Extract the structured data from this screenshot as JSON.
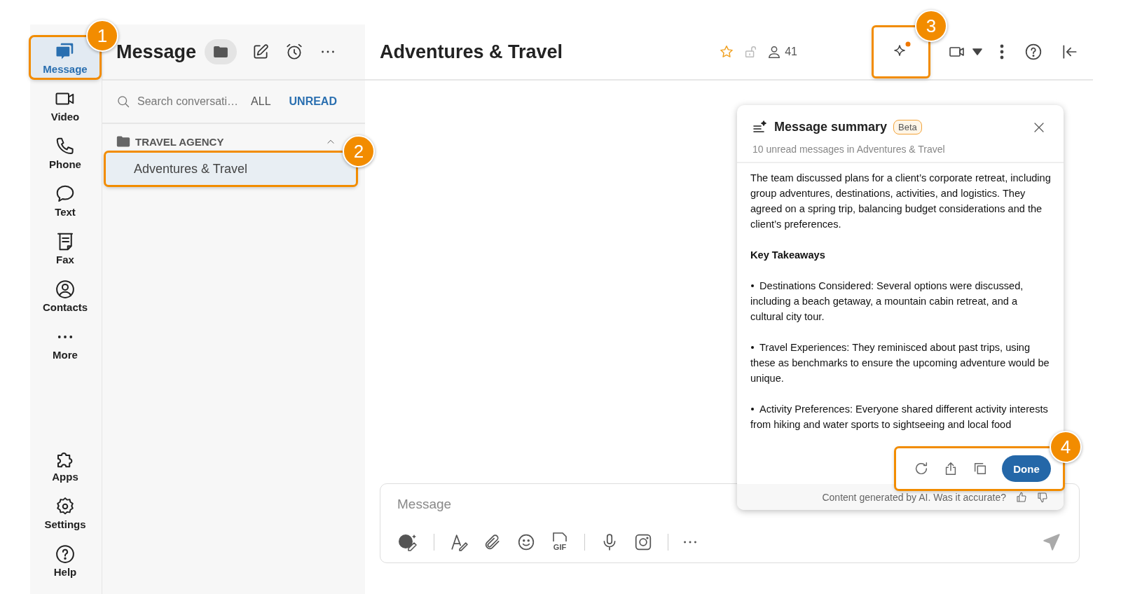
{
  "rail": {
    "items": [
      {
        "label": "Message",
        "selected": true,
        "callout": "1"
      },
      {
        "label": "Video",
        "selected": false
      },
      {
        "label": "Phone",
        "selected": false
      },
      {
        "label": "Text",
        "selected": false
      },
      {
        "label": "Fax",
        "selected": false
      },
      {
        "label": "Contacts",
        "selected": false
      },
      {
        "label": "More",
        "selected": false
      }
    ],
    "bottom_items": [
      {
        "label": "Apps"
      },
      {
        "label": "Settings"
      },
      {
        "label": "Help"
      }
    ]
  },
  "conversations": {
    "title": "Message",
    "search": {
      "placeholder": "Search conversati…"
    },
    "filters": [
      {
        "label": "ALL",
        "selected": false
      },
      {
        "label": "UNREAD",
        "selected": true
      }
    ],
    "folders": [
      {
        "label": "TRAVEL AGENCY",
        "expanded": true,
        "children": [
          {
            "label": "Adventures & Travel",
            "selected": true,
            "callout": "2"
          }
        ]
      }
    ]
  },
  "channel": {
    "title": "Adventures & Travel",
    "member_count": "41",
    "ai_button": {
      "callout": "3"
    }
  },
  "summary": {
    "title": "Message summary",
    "badge": "Beta",
    "subtitle": "10 unread messages in Adventures & Travel",
    "sections": [
      {
        "kind": "paragraph",
        "text": "The team discussed plans for a client’s corporate retreat, including group adventures, destinations, activities, and logistics. They agreed on a spring trip, balancing budget considerations and the client’s preferences."
      },
      {
        "kind": "heading",
        "text": "Key Takeaways"
      },
      {
        "kind": "bullet",
        "text": "Destinations Considered: Several options were discussed, including a beach getaway, a mountain cabin retreat, and a cultural city tour."
      },
      {
        "kind": "bullet",
        "text": "Travel Experiences: They reminisced about past trips, using these as benchmarks to ensure the upcoming adventure would be unique."
      },
      {
        "kind": "bullet",
        "text": "Activity Preferences: Everyone shared different activity interests from hiking and water sports to sightseeing and local food"
      }
    ],
    "actions_callout": "4",
    "done": "Done",
    "footer": "Content generated by AI. Was it accurate?"
  },
  "composer": {
    "placeholder": "Message",
    "gif_label": "GIF"
  }
}
